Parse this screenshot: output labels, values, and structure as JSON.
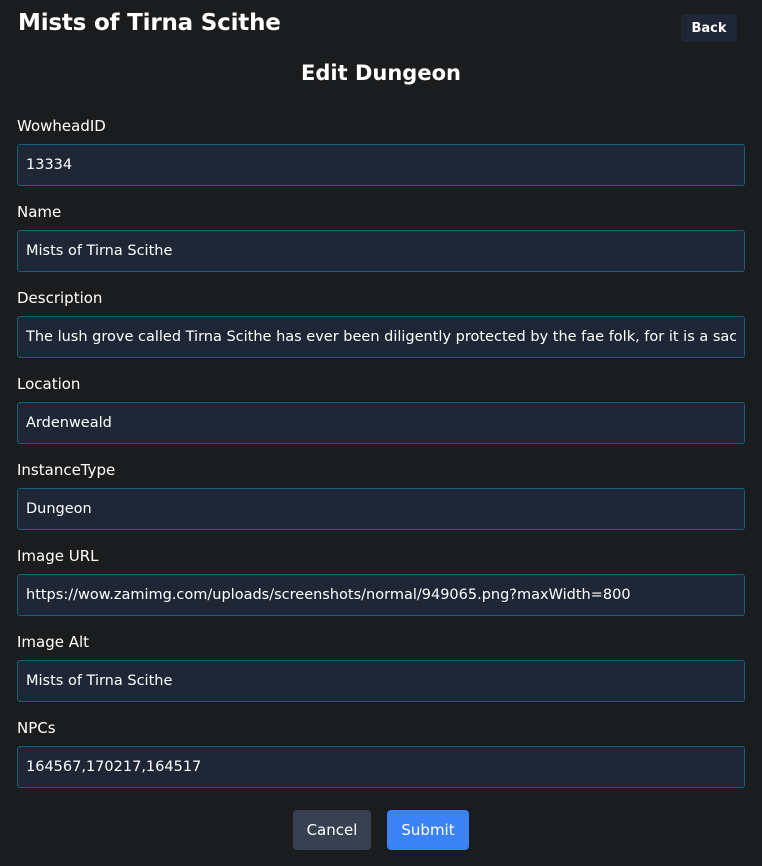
{
  "header": {
    "title": "Mists of Tirna Scithe",
    "back_label": "Back"
  },
  "form": {
    "title": "Edit Dungeon",
    "fields": [
      {
        "label": "WowheadID",
        "value": "13334"
      },
      {
        "label": "Name",
        "value": "Mists of Tirna Scithe"
      },
      {
        "label": "Description",
        "value": "The lush grove called Tirna Scithe has ever been diligently protected by the fae folk, for it is a sacred"
      },
      {
        "label": "Location",
        "value": "Ardenweald"
      },
      {
        "label": "InstanceType",
        "value": "Dungeon"
      },
      {
        "label": "Image URL",
        "value": "https://wow.zamimg.com/uploads/screenshots/normal/949065.png?maxWidth=800"
      },
      {
        "label": "Image Alt",
        "value": "Mists of Tirna Scithe"
      },
      {
        "label": "NPCs",
        "value": "164567,170217,164517"
      }
    ],
    "cancel_label": "Cancel",
    "submit_label": "Submit"
  },
  "colors": {
    "background": "#1b1c1d",
    "input_background": "#1f2636",
    "input_border": "#16607a",
    "cancel_button": "#374151",
    "submit_button": "#3b82f6"
  }
}
